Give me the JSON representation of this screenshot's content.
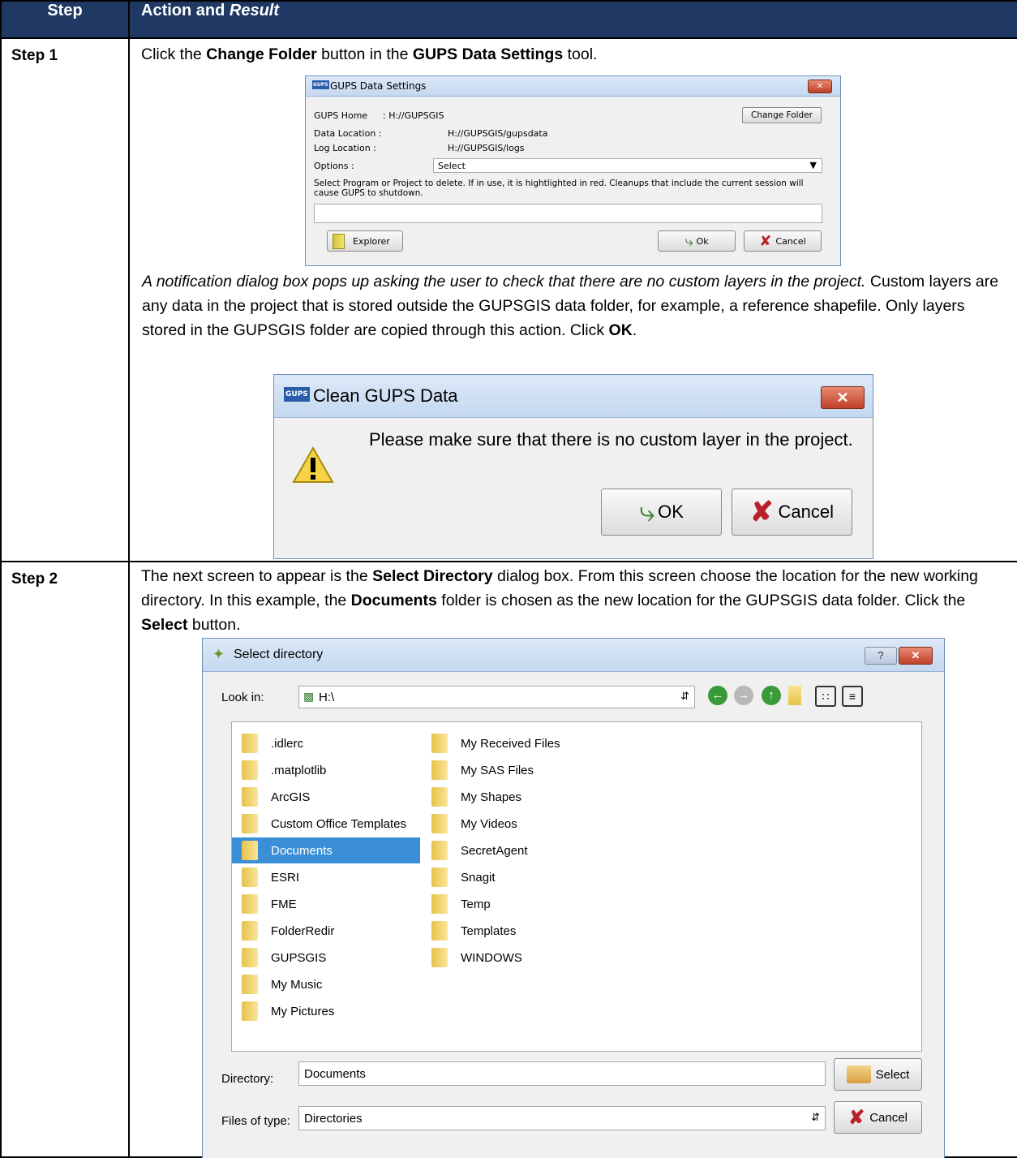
{
  "table": {
    "header_step": "Step",
    "header_action": "Action and ",
    "header_result": "Result",
    "step1_label": "Step 1",
    "step2_label": "Step 2"
  },
  "step1": {
    "intro_pre": "Click the ",
    "intro_b1": "Change Folder",
    "intro_mid": " button in the ",
    "intro_b2": "GUPS Data Settings",
    "intro_post": " tool.",
    "note_italic": "A notification dialog box pops up asking the user to check that there are no custom layers in the project.",
    "note_rest": " Custom layers are any data in the project that is stored outside the GUPSGIS data folder, for example, a reference shapefile. Only layers stored in the GUPSGIS folder are copied through this action. Click ",
    "note_ok": "OK",
    "note_end": "."
  },
  "settings_dialog": {
    "icon_text": "GUPS",
    "title": "GUPS Data Settings",
    "close": "✕",
    "home_label": "GUPS Home",
    "home_value": ": H://GUPSGIS",
    "change_folder": "Change Folder",
    "data_label": "Data Location :",
    "data_value": "H://GUPSGIS/gupsdata",
    "log_label": "Log Location :",
    "log_value": "H://GUPSGIS/logs",
    "options_label": "Options :",
    "options_value": "Select",
    "instructions": "Select Program or Project to delete. If in use, it is hightlighted in red. Cleanups that include the current session will cause GUPS to shutdown.",
    "explorer": "Explorer",
    "ok": "Ok",
    "cancel": "Cancel"
  },
  "clean_dialog": {
    "icon_text": "GUPS",
    "title": "Clean GUPS Data",
    "close": "✕",
    "message": "Please make sure that there is no custom layer in the project.",
    "ok": "OK",
    "cancel": "Cancel"
  },
  "step2": {
    "t1": "The next screen to appear is the ",
    "b1": "Select Directory",
    "t2": " dialog box. From this screen choose the location for the new working directory. In this example, the ",
    "b2": "Documents",
    "t3": " folder is chosen as the new location for the GUPSGIS data folder. Click the ",
    "b3": "Select",
    "t4": " button."
  },
  "dir_dialog": {
    "title": "Select directory",
    "help": "?",
    "close": "✕",
    "look_in_label": "Look in:",
    "look_in_value": "H:\\",
    "col1": [
      ".idlerc",
      ".matplotlib",
      "ArcGIS",
      "Custom Office Templates",
      "Documents",
      "ESRI",
      "FME",
      "FolderRedir",
      "GUPSGIS",
      "My Music",
      "My Pictures"
    ],
    "col2": [
      "My Received Files",
      "My SAS Files",
      "My Shapes",
      "My Videos",
      "SecretAgent",
      "Snagit",
      "Temp",
      "Templates",
      "WINDOWS"
    ],
    "selected": "Documents",
    "directory_label": "Directory:",
    "directory_value": "Documents",
    "select_button": "Select",
    "type_label": "Files of type:",
    "type_value": "Directories",
    "cancel_button": "Cancel"
  }
}
